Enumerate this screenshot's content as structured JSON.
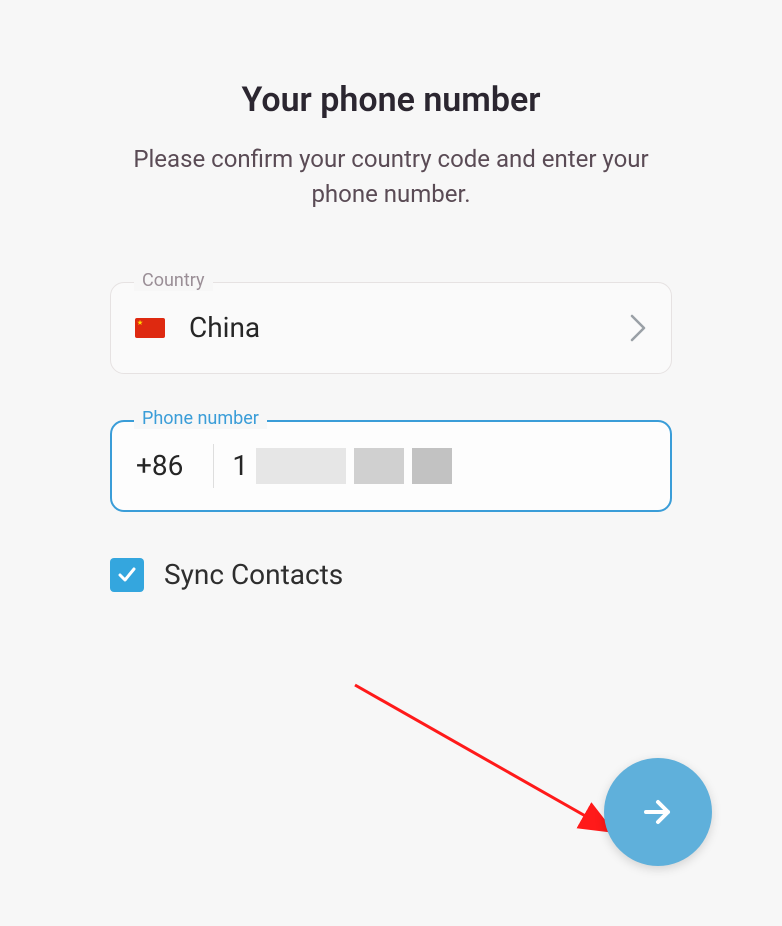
{
  "header": {
    "title": "Your phone number",
    "subtitle": "Please confirm your country code and enter your phone number."
  },
  "country_field": {
    "label": "Country",
    "selected_name": "China",
    "flag": "china-flag"
  },
  "phone_field": {
    "label": "Phone number",
    "country_code": "+86",
    "number": "1"
  },
  "sync": {
    "label": "Sync Contacts",
    "checked": true
  },
  "colors": {
    "accent": "#3a9dd8",
    "fab": "#5fb0db"
  }
}
